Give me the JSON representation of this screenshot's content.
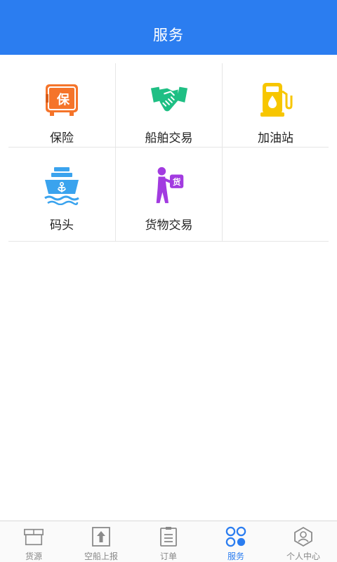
{
  "header": {
    "title": "服务"
  },
  "services": [
    {
      "label": "保险",
      "icon": "insurance-safe-icon",
      "color": "#f5742a"
    },
    {
      "label": "船舶交易",
      "icon": "handshake-icon",
      "color": "#1fbf84"
    },
    {
      "label": "加油站",
      "icon": "fuel-pump-icon",
      "color": "#f7c600"
    },
    {
      "label": "码头",
      "icon": "ship-anchor-icon",
      "color": "#3aa3ee"
    },
    {
      "label": "货物交易",
      "icon": "person-carrying-goods-icon",
      "color": "#a23be0",
      "badge": "货"
    }
  ],
  "tabbar": {
    "active_color": "#2b7df0",
    "items": [
      {
        "label": "货源",
        "icon": "cargo-box-icon"
      },
      {
        "label": "空船上报",
        "icon": "upload-arrow-icon"
      },
      {
        "label": "订单",
        "icon": "order-list-icon"
      },
      {
        "label": "服务",
        "icon": "services-grid-icon",
        "active": true
      },
      {
        "label": "个人中心",
        "icon": "profile-icon"
      }
    ]
  }
}
